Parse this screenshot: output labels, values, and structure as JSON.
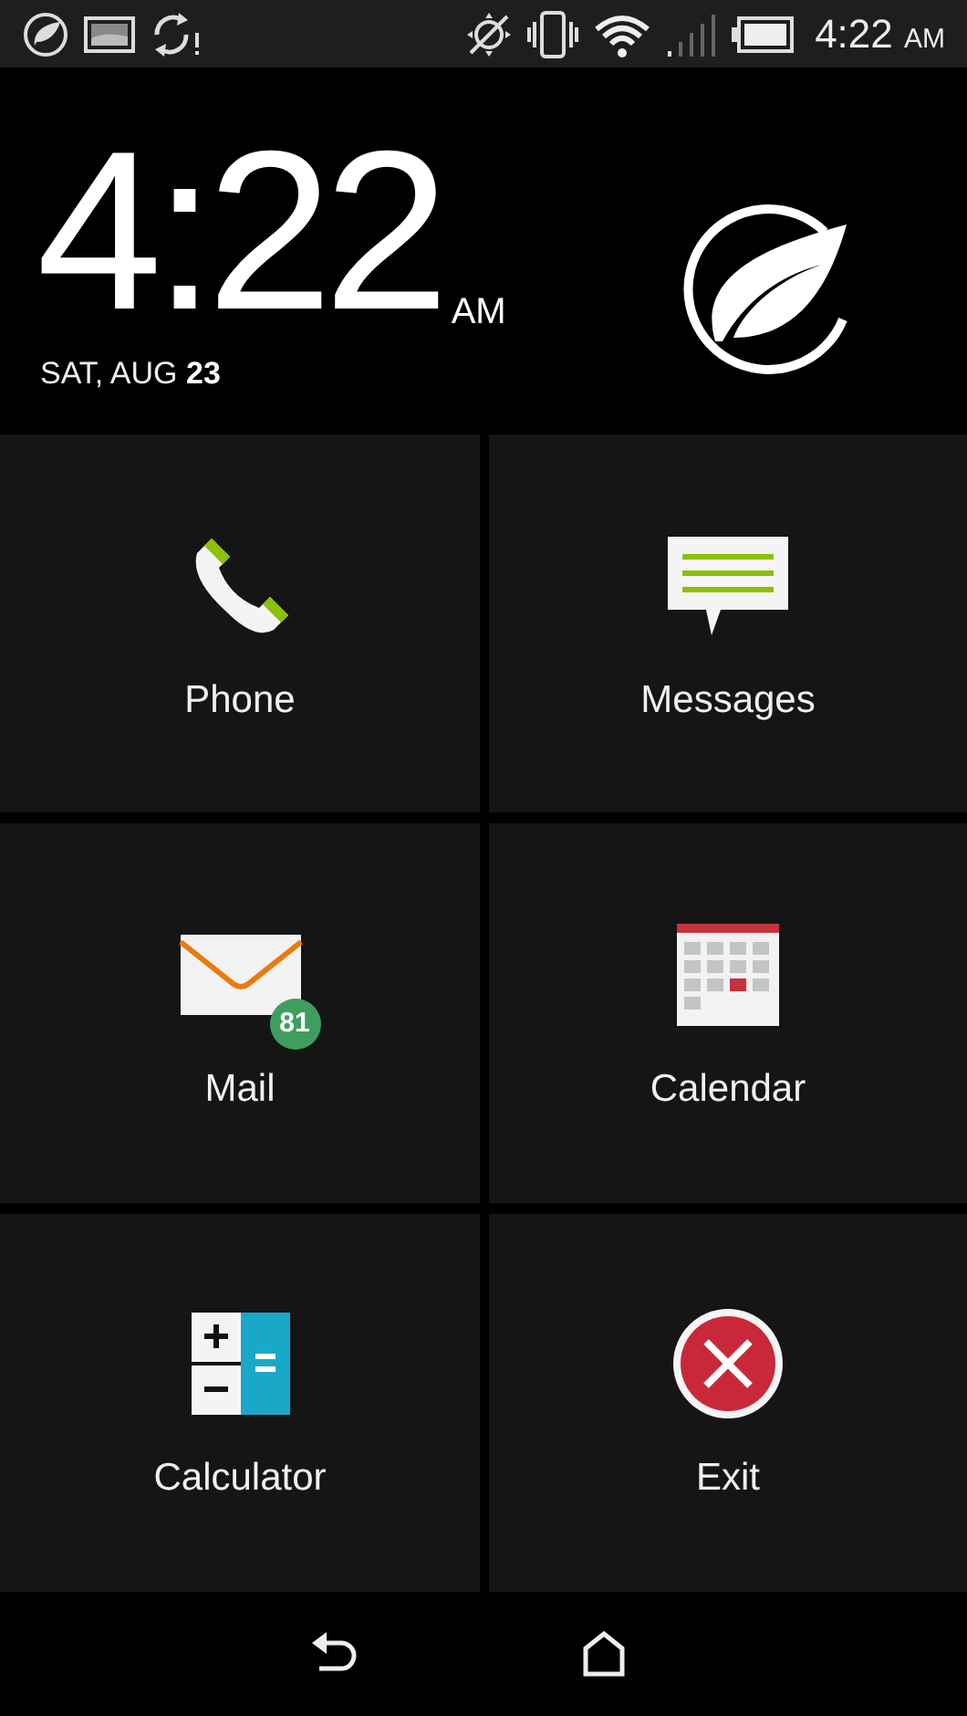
{
  "status_bar": {
    "time": "4:22",
    "meridiem": "AM"
  },
  "clock": {
    "time": "4:22",
    "meridiem": "AM",
    "date": "SAT, AUG **23**"
  },
  "tiles": [
    {
      "kind": "phone",
      "label": "Phone"
    },
    {
      "kind": "messages",
      "label": "Messages"
    },
    {
      "kind": "mail",
      "label": "Mail",
      "badge": "81"
    },
    {
      "kind": "calendar",
      "label": "Calendar"
    },
    {
      "kind": "calculator",
      "label": "Calculator"
    },
    {
      "kind": "exit",
      "label": "Exit"
    }
  ]
}
